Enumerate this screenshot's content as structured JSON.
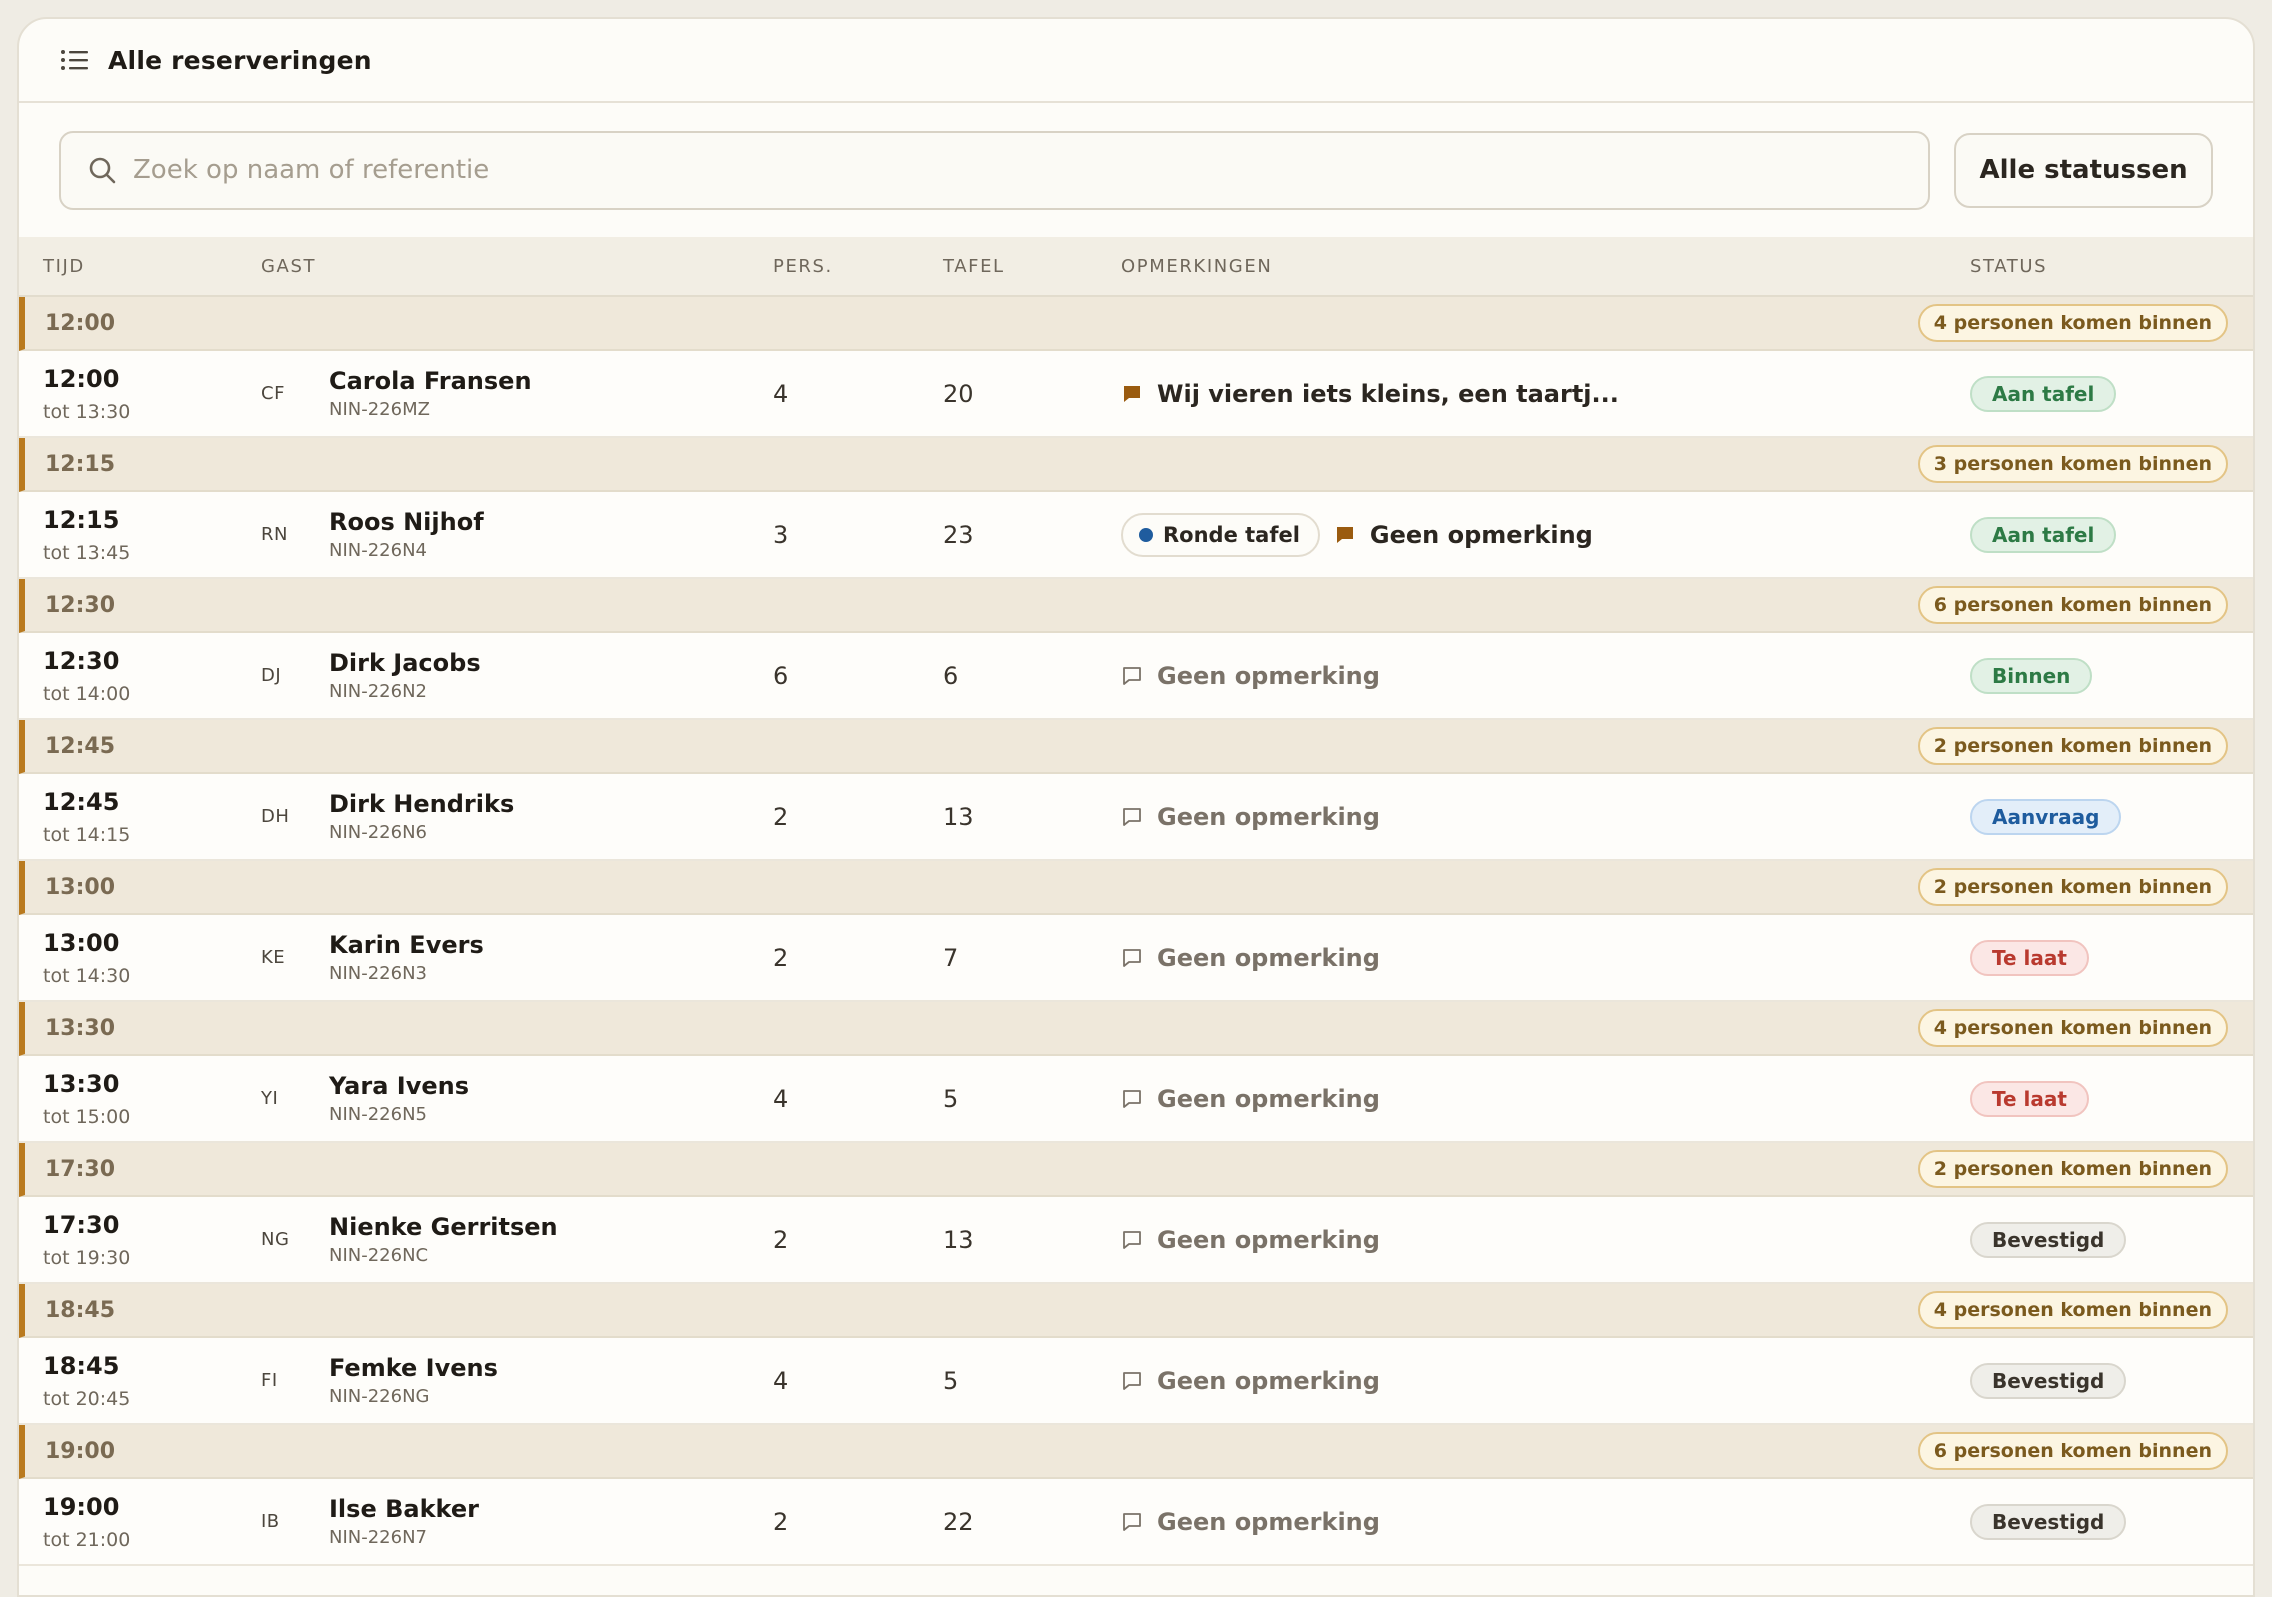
{
  "header": {
    "title": "Alle reserveringen",
    "icon": "list-icon"
  },
  "toolbar": {
    "search_placeholder": "Zoek op naam of referentie",
    "status_filter_label": "Alle statussen"
  },
  "columns": {
    "time": "TIJD",
    "guest": "GAST",
    "pers": "PERS.",
    "table": "TAFEL",
    "notes": "OPMERKINGEN",
    "status": "STATUS"
  },
  "colors": {
    "accent": "#b97a1f",
    "note_icon": "#9a5b0f",
    "status_green": "#2d7a45",
    "status_blue": "#1f5c9e",
    "status_red": "#b93a2f"
  },
  "groups": [
    {
      "time": "12:00",
      "arrivals": "4 personen komen binnen",
      "reservation": {
        "start": "12:00",
        "end": "tot 13:30",
        "initials": "CF",
        "name": "Carola Fransen",
        "ref": "NIN-226MZ",
        "pers": "4",
        "table": "20",
        "tag": "",
        "note": "Wij vieren iets kleins, een taartj...",
        "note_filled": true,
        "status": "Aan tafel",
        "status_tone": "green"
      }
    },
    {
      "time": "12:15",
      "arrivals": "3 personen komen binnen",
      "reservation": {
        "start": "12:15",
        "end": "tot 13:45",
        "initials": "RN",
        "name": "Roos Nijhof",
        "ref": "NIN-226N4",
        "pers": "3",
        "table": "23",
        "tag": "Ronde tafel",
        "note": "Geen opmerking",
        "note_filled": true,
        "status": "Aan tafel",
        "status_tone": "green"
      }
    },
    {
      "time": "12:30",
      "arrivals": "6 personen komen binnen",
      "reservation": {
        "start": "12:30",
        "end": "tot 14:00",
        "initials": "DJ",
        "name": "Dirk Jacobs",
        "ref": "NIN-226N2",
        "pers": "6",
        "table": "6",
        "tag": "",
        "note": "Geen opmerking",
        "note_filled": false,
        "status": "Binnen",
        "status_tone": "green"
      }
    },
    {
      "time": "12:45",
      "arrivals": "2 personen komen binnen",
      "reservation": {
        "start": "12:45",
        "end": "tot 14:15",
        "initials": "DH",
        "name": "Dirk Hendriks",
        "ref": "NIN-226N6",
        "pers": "2",
        "table": "13",
        "tag": "",
        "note": "Geen opmerking",
        "note_filled": false,
        "status": "Aanvraag",
        "status_tone": "blue"
      }
    },
    {
      "time": "13:00",
      "arrivals": "2 personen komen binnen",
      "reservation": {
        "start": "13:00",
        "end": "tot 14:30",
        "initials": "KE",
        "name": "Karin Evers",
        "ref": "NIN-226N3",
        "pers": "2",
        "table": "7",
        "tag": "",
        "note": "Geen opmerking",
        "note_filled": false,
        "status": "Te laat",
        "status_tone": "red"
      }
    },
    {
      "time": "13:30",
      "arrivals": "4 personen komen binnen",
      "reservation": {
        "start": "13:30",
        "end": "tot 15:00",
        "initials": "YI",
        "name": "Yara Ivens",
        "ref": "NIN-226N5",
        "pers": "4",
        "table": "5",
        "tag": "",
        "note": "Geen opmerking",
        "note_filled": false,
        "status": "Te laat",
        "status_tone": "red"
      }
    },
    {
      "time": "17:30",
      "arrivals": "2 personen komen binnen",
      "reservation": {
        "start": "17:30",
        "end": "tot 19:30",
        "initials": "NG",
        "name": "Nienke Gerritsen",
        "ref": "NIN-226NC",
        "pers": "2",
        "table": "13",
        "tag": "",
        "note": "Geen opmerking",
        "note_filled": false,
        "status": "Bevestigd",
        "status_tone": "grey"
      }
    },
    {
      "time": "18:45",
      "arrivals": "4 personen komen binnen",
      "reservation": {
        "start": "18:45",
        "end": "tot 20:45",
        "initials": "FI",
        "name": "Femke Ivens",
        "ref": "NIN-226NG",
        "pers": "4",
        "table": "5",
        "tag": "",
        "note": "Geen opmerking",
        "note_filled": false,
        "status": "Bevestigd",
        "status_tone": "grey"
      }
    },
    {
      "time": "19:00",
      "arrivals": "6 personen komen binnen",
      "reservation": {
        "start": "19:00",
        "end": "tot 21:00",
        "initials": "IB",
        "name": "Ilse Bakker",
        "ref": "NIN-226N7",
        "pers": "2",
        "table": "22",
        "tag": "",
        "note": "Geen opmerking",
        "note_filled": false,
        "status": "Bevestigd",
        "status_tone": "grey"
      }
    }
  ]
}
